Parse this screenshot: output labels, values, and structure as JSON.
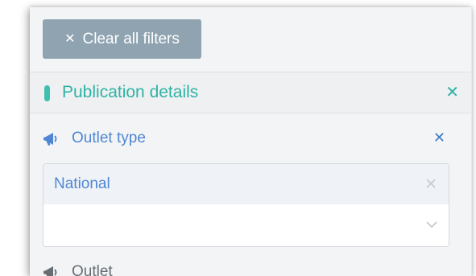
{
  "clear_button": {
    "icon": "close-icon",
    "label": "Clear all filters"
  },
  "section": {
    "title": "Publication details",
    "close_icon": "close-icon",
    "accent_color": "#2fb3a6"
  },
  "outlet_type_filter": {
    "icon": "megaphone-icon",
    "label": "Outlet type",
    "close_icon": "close-icon",
    "selected_values": [
      "National"
    ],
    "remove_icon": "close-icon",
    "dropdown_icon": "chevron-down-icon"
  },
  "outlet_filter": {
    "icon": "megaphone-icon",
    "label": "Outlet"
  }
}
